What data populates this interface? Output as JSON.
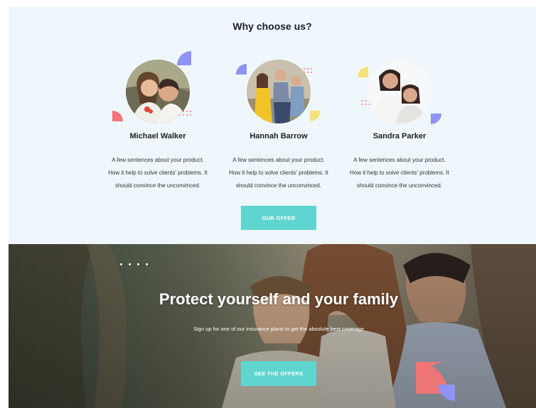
{
  "why_section": {
    "title_bold": "Why",
    "title_rest": " choose us?",
    "cards": [
      {
        "name": "Michael Walker",
        "text": [
          "A few sentences about your product.",
          "How it help to solve clients' problems. It",
          "should convince the unconvinced."
        ]
      },
      {
        "name": "Hannah Barrow",
        "text": [
          "A few sentences about your product.",
          "How it help to solve clients' problems. It",
          "should convince the unconvinced."
        ]
      },
      {
        "name": "Sandra Parker",
        "text": [
          "A few sentences about your product.",
          "How it help to solve clients' problems. It",
          "should convince the unconvinced."
        ]
      }
    ],
    "button_label": "OUR OFFER"
  },
  "hero": {
    "title": "Protect yourself and your family",
    "subtitle": "Sign up for one of our insurance plans to get the absolute best coverage",
    "button_label": "SEE THE OFFERS"
  },
  "colors": {
    "section_bg": "#eff7fc",
    "accent_teal": "#5ed6cf",
    "accent_coral": "#f27474",
    "accent_violet": "#8f93f5",
    "accent_yellow": "#f5e27a"
  }
}
